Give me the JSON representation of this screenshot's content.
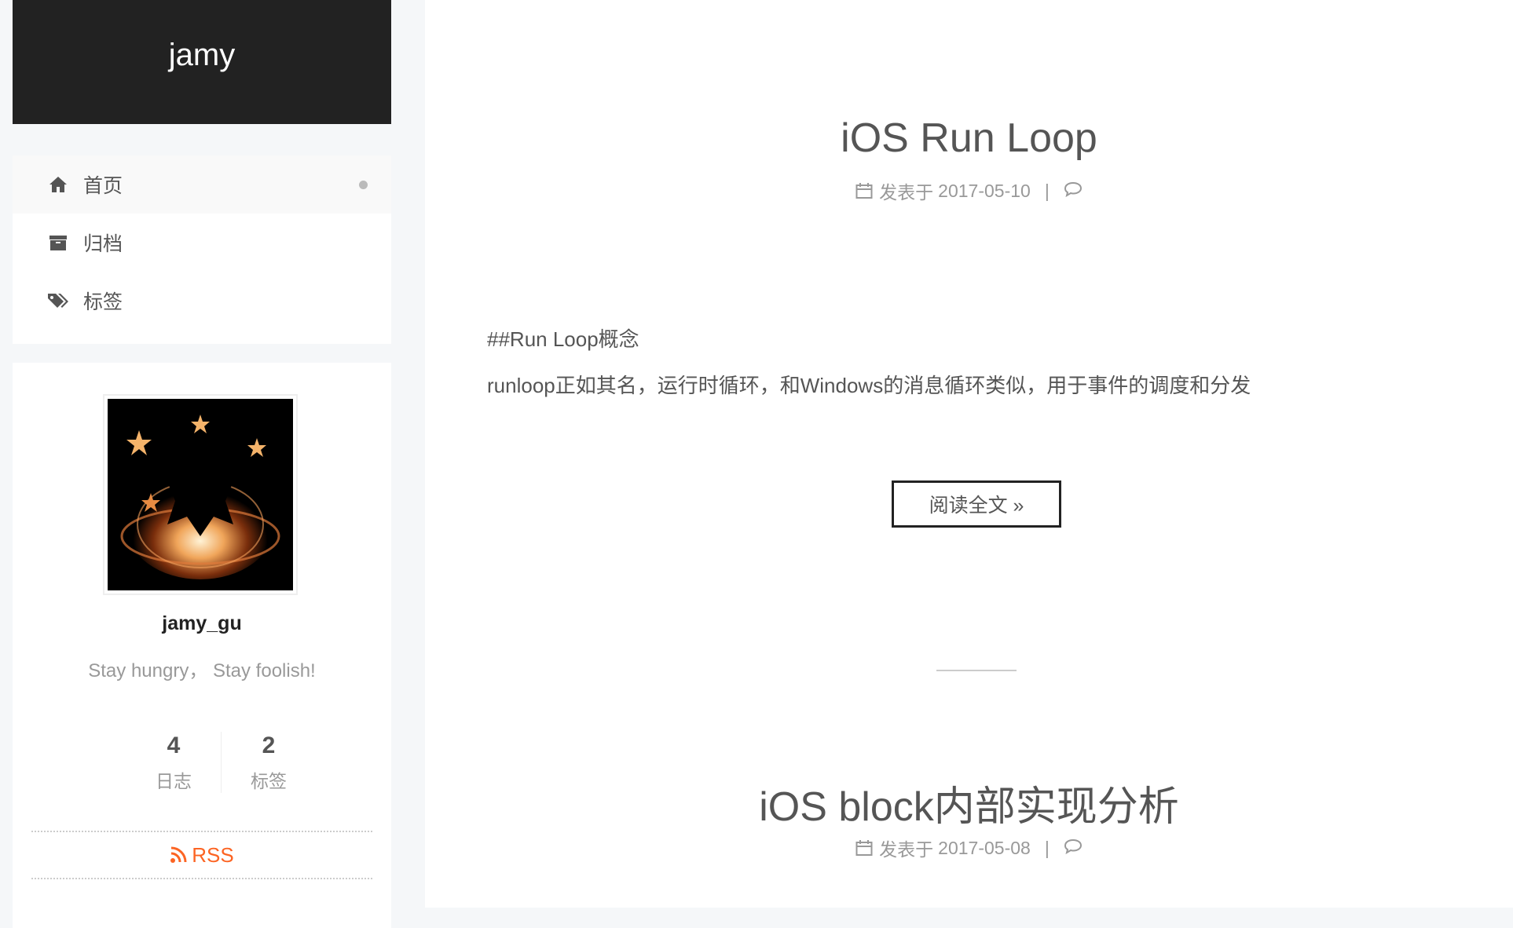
{
  "site": {
    "title": "jamy"
  },
  "menu": {
    "items": [
      {
        "label": "首页",
        "icon": "home-icon",
        "active": true
      },
      {
        "label": "归档",
        "icon": "archive-icon",
        "active": false
      },
      {
        "label": "标签",
        "icon": "tags-icon",
        "active": false
      }
    ]
  },
  "overview": {
    "author": "jamy_gu",
    "description": "Stay hungry， Stay foolish!",
    "stats": [
      {
        "count": "4",
        "name": "日志"
      },
      {
        "count": "2",
        "name": "标签"
      }
    ],
    "rss_label": "RSS"
  },
  "posts": [
    {
      "title": "iOS Run Loop",
      "meta_prefix": "发表于",
      "date": "2017-05-10",
      "meta_sep": "|",
      "body": [
        "##Run Loop概念",
        "runloop正如其名，运行时循环，和Windows的消息循环类似，用于事件的调度和分发"
      ],
      "read_more": "阅读全文 »"
    },
    {
      "title": "iOS block内部实现分析",
      "meta_prefix": "发表于",
      "date": "2017-05-08",
      "meta_sep": "|"
    }
  ],
  "colors": {
    "brand_bg": "#222222",
    "rss": "#fc6423",
    "muted": "#999999"
  }
}
